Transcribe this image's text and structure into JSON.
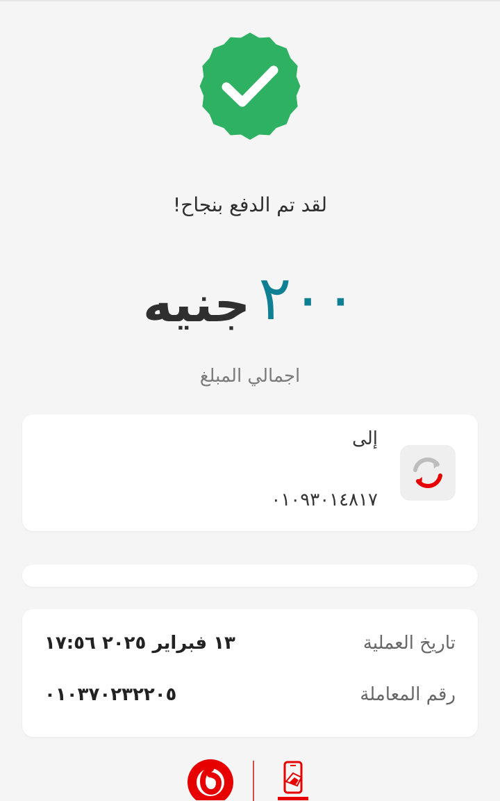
{
  "status": {
    "message": "لقد تم الدفع بنجاح!"
  },
  "amount": {
    "value": "٢٠٠",
    "currency": "جنيه",
    "label": "اجمالي المبلغ"
  },
  "recipient": {
    "label": "إلى",
    "number": "٠١٠٩٣٠١٤٨١٧"
  },
  "details": {
    "operation_date_label": "تاريخ العملية",
    "operation_date_value": "١٣ فبراير ٢٠٢٥  ١٧:٥٦",
    "transaction_number_label": "رقم المعاملة",
    "transaction_number_value": "٠١٠٣٧٠٢٣٢٢٠٥"
  },
  "colors": {
    "success": "#2eb163",
    "amount": "#0f7f93",
    "vodafone_red": "#e60000",
    "background": "#f5f5f5"
  },
  "icons": {
    "status": "success-badge-check-icon",
    "recipient": "transfer-arrows-icon",
    "footer_left": "vodafone-logo-icon",
    "footer_right": "vodafone-cash-logo-icon"
  }
}
